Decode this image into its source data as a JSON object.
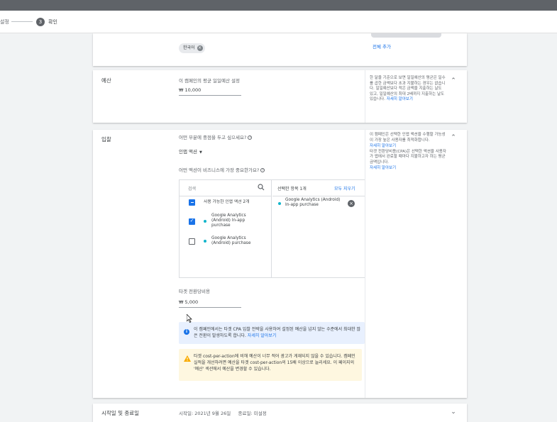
{
  "stepper": {
    "prev_label": "설정",
    "current_number": "3",
    "current_label": "확인"
  },
  "language": {
    "chip_label": "한국어",
    "all_add": "전체 추가"
  },
  "budget": {
    "title": "예산",
    "field_label": "이 캠페인의 평균 일일예산 설정",
    "value": "₩ 10,000",
    "side_text": "한 달을 기준으로 보면 일일예산의 평균은 일수를 곱한 금액보다 초과 지불하는 경우는 없습니다. 일일예산보다 적은 금액을 지출하는 날도 있고, 일일예산의 최대 2배까지 지출하는 날도 있습니다.",
    "side_link": "자세히 알아보기"
  },
  "bidding": {
    "title": "입찰",
    "focus_question": "어떤 부분에 중점을 두고 싶으세요?",
    "focus_value": "인앱 액션",
    "important_question": "어떤 액션이 비즈니스에 가장 중요한가요?",
    "search_placeholder": "검색",
    "available_label": "사용 가능한 인앱 액션 2개",
    "items": [
      {
        "label": "Google Analytics (Android) In-app purchase",
        "checked": true
      },
      {
        "label": "Google Analytics (Android) purchase",
        "checked": false
      }
    ],
    "selected_header": "선택한 항목 1개",
    "clear_all": "모두 지우기",
    "selected_items": [
      "Google Analytics (Android) In-app purchase"
    ],
    "target_cpa_label": "타겟 전환당비용",
    "target_cpa_value": "₩ 5,000",
    "info_text": "이 캠페인에서는 타겟 CPA 입찰 전략을 사용하여 설정된 예산을 넘지 않는 수준에서 최대한 많은 전환이 발생하도록 합니다.",
    "info_link": "자세히 알아보기",
    "warn_text": "타겟 cost-per-action에 비해 예산이 너무 적어 광고가 게재되지 않을 수 있습니다. 캠페인 실적을 개선하려면 예산을 타겟 cost-per-action의 15배 이상으로 늘리세요. 이 페이지의 '예산' 섹션에서 예산을 변경할 수 있습니다.",
    "side_text_1": "이 캠페인은 선택한 인앱 액션을 수행할 가능성이 가장 높은 사용자를 최적화합니다.",
    "side_link_1": "자세히 알아보기",
    "side_text_2": "타겟 전환당비용(CPA)은 선택한 액션을 사용자가 앱에서 완료할 때마다 지불하고자 하는 평균 금액입니다.",
    "side_link_2": "자세히 알아보기"
  },
  "dates": {
    "title": "시작일 및 종료일",
    "summary": "시작일: 2021년 9월 26일     종료일: 미설정"
  }
}
